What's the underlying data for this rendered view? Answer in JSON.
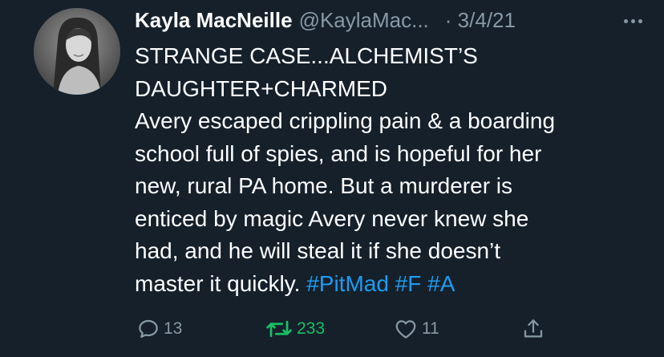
{
  "tweet": {
    "author_name": "Kayla MacNeille",
    "handle": "@KaylaMac...",
    "date": "· 3/4/21",
    "title_line1": "STRANGE CASE...ALCHEMIST’S",
    "title_line2": "DAUGHTER+CHARMED",
    "text_line1": "Avery escaped crippling pain & a boarding",
    "text_line2": "school full of spies, and is hopeful for her",
    "text_line3": "new, rural PA home. But a murderer is",
    "text_line4": "enticed by magic Avery never knew she",
    "text_line5": "had, and he will steal it if she doesn’t",
    "text_line6": "master it quickly.",
    "hashtags": [
      "#PitMad",
      "#F",
      "#A"
    ]
  },
  "actions": {
    "reply_count": "13",
    "retweet_count": "233",
    "like_count": "11"
  },
  "icons": [
    "reply-icon",
    "retweet-icon",
    "like-icon",
    "share-icon",
    "more-icon"
  ],
  "colors": {
    "background": "#15202b",
    "text": "#ffffff",
    "secondary": "#8899a6",
    "hashtag": "#1d9bf0",
    "retweet_active": "#17bf63"
  }
}
